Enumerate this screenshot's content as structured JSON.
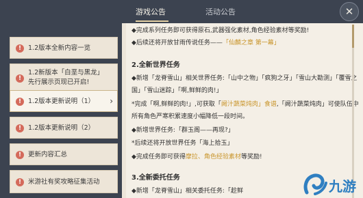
{
  "tabs": [
    {
      "label": "游戏公告",
      "active": true
    },
    {
      "label": "活动公告",
      "active": false
    }
  ],
  "close_symbol": "✕",
  "sidebar": {
    "items": [
      {
        "label": "1.2版本全新内容一览",
        "selected": false
      },
      {
        "label": "1.2新版本「白垩与黑龙」先行展示页现已开启!",
        "selected": false
      },
      {
        "label": "1.2版本更新说明（1）",
        "selected": true
      },
      {
        "label": "1.2版本更新说明（2）",
        "selected": false
      },
      {
        "label": "更新内容汇总",
        "selected": false
      },
      {
        "label": "米游社有奖攻略征集活动",
        "selected": false
      }
    ]
  },
  "content": {
    "lines": [
      {
        "text": "◆完成系列任务即可获得原石,武器强化素材,角色经验素材等奖励!",
        "type": "normal"
      },
      {
        "text": "◆后续还将开放甘雨传说任务——",
        "highlight": "「仙麟之章 第一幕」",
        "type": "normal"
      },
      {
        "text": "2.全新世界任务",
        "type": "head"
      },
      {
        "text": "◆新增「龙脊雪山」相关世界任务:「山中之物」「疯狗之牙」「雪山大勘测」「覆雪之",
        "type": "normal"
      },
      {
        "text": "国」「雪山迷踪」「啊,鲜鲜的肉!」",
        "type": "normal"
      },
      {
        "text": "*完成「啊,鲜鲜的肉!」,可获取「",
        "highlight": "阙汁蔬菜炖肉」食谱",
        "after": ",「阙汁蔬菜炖肉」可使队伍中",
        "type": "normal"
      },
      {
        "text": "所有角色严寒积累速度小幅降低一段时间。",
        "type": "normal"
      },
      {
        "text": "◆新增世界任务:「群玉阁——再现?」",
        "type": "normal"
      },
      {
        "text": "*后续还将开放世界任务「海上拾玉」",
        "type": "normal"
      },
      {
        "text": "◆完成任务即可获得",
        "highlight": "摩拉、角色经验素材",
        "after": "等奖励!",
        "type": "normal"
      },
      {
        "text": "3.全新委托任务",
        "type": "head"
      },
      {
        "text": "◆新增「龙脊雪山」相关委托任务:「趁鲜",
        "type": "normal"
      }
    ]
  },
  "watermark": {
    "text": "九游"
  },
  "colors": {
    "topbar": "#3c4350",
    "accent": "#e6d2a5",
    "item_icon": "#d46a5b",
    "highlight": "#c9952b"
  }
}
